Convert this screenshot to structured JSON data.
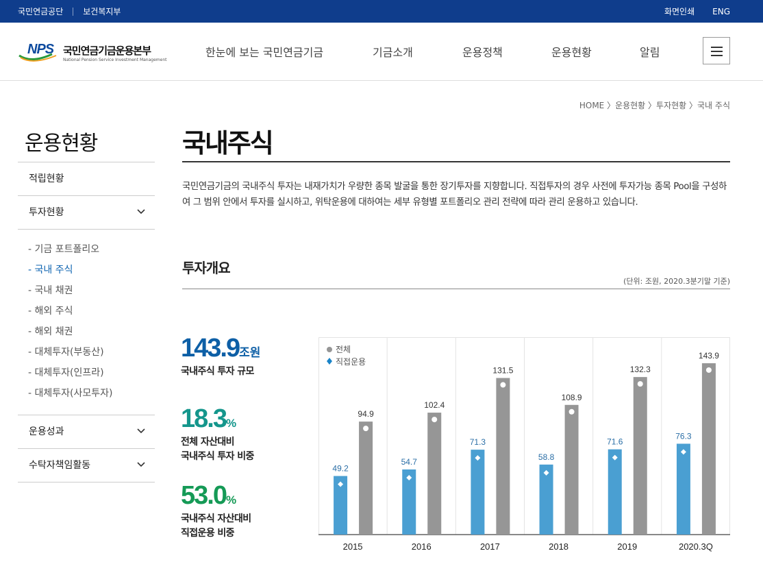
{
  "topbar": {
    "links": [
      "국민연금공단",
      "보건복지부"
    ],
    "print": "화면인쇄",
    "lang": "ENG"
  },
  "logo": {
    "mark": "NPS",
    "title": "국민연금기금운용본부",
    "subtitle": "National Pension Service Investment Management"
  },
  "gnb": [
    "한눈에 보는 국민연금기금",
    "기금소개",
    "운용정책",
    "운용현황",
    "알림"
  ],
  "breadcrumb": "HOME 〉운용현황 〉투자현황 〉국내 주식",
  "sidebar": {
    "title": "운용현황",
    "items": [
      {
        "label": "적립현황"
      },
      {
        "label": "투자현황"
      },
      {
        "label": "운용성과"
      },
      {
        "label": "수탁자책임활동"
      }
    ],
    "sub_items": [
      "- 기금 포트폴리오",
      "- 국내 주식",
      "- 국내 채권",
      "- 해외 주식",
      "- 해외 채권",
      "- 대체투자(부동산)",
      "- 대체투자(인프라)",
      "- 대체투자(사모투자)"
    ],
    "active_sub": 1
  },
  "page": {
    "title": "국내주식",
    "intro": "국민연금기금의 국내주식 투자는 내재가치가 우량한 종목 발굴을 통한 장기투자를 지향합니다. 직접투자의 경우 사전에 투자가능 종목 Pool을 구성하여 그 범위 안에서 투자를 실시하고, 위탁운용에 대하여는 세부 유형별 포트폴리오 관리 전략에 따라 관리 운용하고 있습니다.",
    "section_title": "투자개요",
    "unit": "(단위: 조원, 2020.3분기말 기준)"
  },
  "stats": [
    {
      "value": "143.9",
      "unit": "조원",
      "label1": "국내주식 투자 규모",
      "label2": "",
      "color": "#0d5fa6"
    },
    {
      "value": "18.3",
      "unit": "%",
      "label1": "전체 자산대비",
      "label2": "국내주식 투자 비중",
      "color": "#14968c"
    },
    {
      "value": "53.0",
      "unit": "%",
      "label1": "국내주식 자산대비",
      "label2": "직접운용 비중",
      "color": "#159a56"
    }
  ],
  "chart_data": {
    "type": "bar",
    "categories": [
      "2015",
      "2016",
      "2017",
      "2018",
      "2019",
      "2020.3Q"
    ],
    "series": [
      {
        "name": "직접운용",
        "values": [
          49.2,
          54.7,
          71.3,
          58.8,
          71.6,
          76.3
        ],
        "color": "#4a9fd2"
      },
      {
        "name": "전체",
        "values": [
          94.9,
          102.4,
          131.5,
          108.9,
          132.3,
          143.9
        ],
        "color": "#969696"
      }
    ],
    "ylim": [
      0,
      160
    ],
    "legend": "top-left"
  }
}
